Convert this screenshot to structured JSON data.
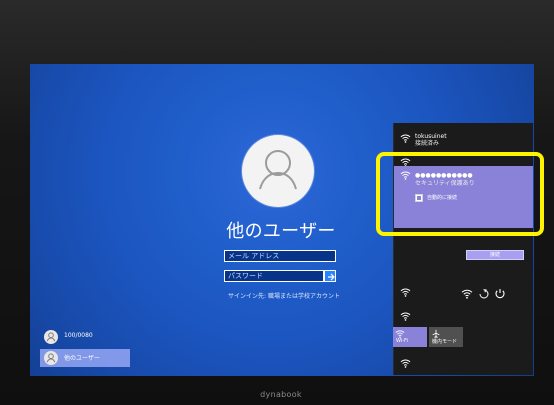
{
  "brand": {
    "bezel_label": "dynabook"
  },
  "login": {
    "username": "他のユーザー",
    "email_placeholder": "メール アドレス",
    "password_placeholder": "パスワード",
    "signin_link": "サインイン先: 職場または学校アカウント"
  },
  "users": [
    {
      "label": "100/0080"
    },
    {
      "label": "他のユーザー"
    }
  ],
  "network_panel": {
    "top_network": {
      "name": "tokusuinet",
      "status": "接続済み"
    },
    "selected_network": {
      "name": "●●●●●●●●●●●",
      "status": "セキュリティ保護あり",
      "auto_connect": "自動的に接続",
      "connect_button": "接続"
    }
  },
  "quick_actions": {
    "wifi": "Wi-Fi",
    "airplane": "機内モード"
  },
  "colors": {
    "screen_blue": "#1c55bf",
    "selected_network": "#8a82d8",
    "highlight": "#fff400"
  },
  "icons": [
    "user-avatar-icon",
    "arrow-right-icon",
    "wifi-icon",
    "airplane-icon",
    "network-icon",
    "ease-of-access-icon",
    "power-icon"
  ]
}
